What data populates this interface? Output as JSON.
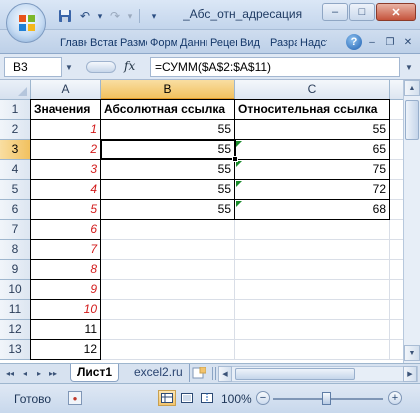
{
  "window": {
    "title": "_Абс_отн_адресация",
    "minimize": "–",
    "maximize": "□",
    "close": "✕"
  },
  "quick_access": {
    "save_icon": "💾",
    "undo_icon": "↶",
    "undo_drop": "▾",
    "redo_icon": "↷",
    "redo_drop": "▾",
    "customize": "▾"
  },
  "ribbon": {
    "tabs": [
      "Главная",
      "Вставка",
      "Разметка",
      "Формулы",
      "Данные",
      "Рецензирование",
      "Вид",
      "Разработчик",
      "Надстройки"
    ],
    "help": "?",
    "min_icon": "–",
    "restore_icon": "❐",
    "close_icon": "✕"
  },
  "formula_bar": {
    "name_box": "B3",
    "fx": "fx",
    "formula": "=СУММ($A$2:$A$11)"
  },
  "grid": {
    "columns": [
      "A",
      "B",
      "C"
    ],
    "selected_column": "B",
    "rows": [
      "1",
      "2",
      "3",
      "4",
      "5",
      "6",
      "7",
      "8",
      "9",
      "10",
      "11",
      "12",
      "13"
    ],
    "selected_row": "3",
    "headers": {
      "A": "Значения",
      "B": "Абсолютная ссылка",
      "C": "Относительная ссылка"
    },
    "col_a": [
      "1",
      "2",
      "3",
      "4",
      "5",
      "6",
      "7",
      "8",
      "9",
      "10",
      "11",
      "12"
    ],
    "col_b": [
      "55",
      "55",
      "55",
      "55",
      "55"
    ],
    "col_c": [
      "55",
      "65",
      "75",
      "72",
      "68"
    ]
  },
  "sheets": {
    "nav": [
      "◂◂",
      "◂",
      "▸",
      "▸▸"
    ],
    "tabs": [
      "Лист1",
      "excel2.ru"
    ],
    "active": "Лист1"
  },
  "status": {
    "ready": "Готово",
    "zoom": "100%",
    "zoom_minus": "−",
    "zoom_plus": "+"
  },
  "colors": {
    "red_values": "#d21b1b",
    "selection_header": "#f1c15f",
    "error_triangle": "#1a8c2a"
  }
}
